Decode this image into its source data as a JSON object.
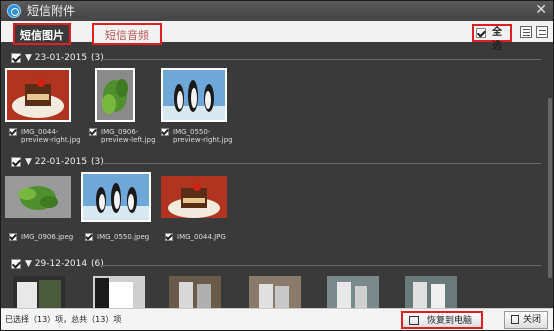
{
  "window": {
    "title": "短信附件",
    "close": "✕"
  },
  "tabs": [
    {
      "label": "短信图片",
      "active": true
    },
    {
      "label": "短信音频",
      "active": false
    }
  ],
  "toolbar": {
    "select_all_label": "全选"
  },
  "groups": [
    {
      "date": "23-01-2015",
      "count": "(3)",
      "items": [
        "IMG_0044-preview-right.jpg",
        "IMG_0906-preview-left.jpg",
        "IMG_0550-preview-right.jpg"
      ]
    },
    {
      "date": "22-01-2015",
      "count": "(3)",
      "items": [
        "IMG_0906.jpeg",
        "IMG_0550.jpeg",
        "IMG_0044.JPG"
      ]
    },
    {
      "date": "29-12-2014",
      "count": "(6)",
      "items": []
    }
  ],
  "status": {
    "text": "已选择（13）项，总共（13）项"
  },
  "buttons": {
    "restore": "恢复到电脑",
    "close": "关闭"
  }
}
